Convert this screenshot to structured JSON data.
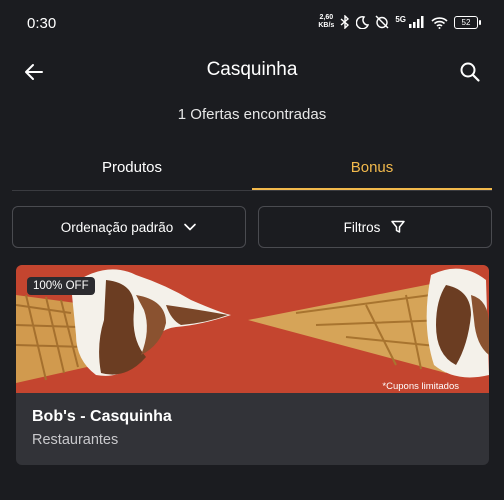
{
  "status_bar": {
    "time": "0:30",
    "net_speed_value": "2,60",
    "net_speed_unit": "KB/s",
    "network_type": "5G",
    "battery": "52"
  },
  "header": {
    "title": "Casquinha"
  },
  "results": {
    "count_text": "1 Ofertas encontradas"
  },
  "tabs": [
    {
      "label": "Produtos",
      "active": false
    },
    {
      "label": "Bonus",
      "active": true
    }
  ],
  "filters": {
    "sort_label": "Ordenação padrão",
    "filter_label": "Filtros"
  },
  "offer": {
    "badge": "100% OFF",
    "coupon_note": "*Cupons limitados",
    "title": "Bob's - Casquinha",
    "category": "Restaurantes"
  },
  "colors": {
    "background": "#1b1c20",
    "accent": "#f2b94c",
    "banner": "#c4452f",
    "card": "#323338"
  }
}
